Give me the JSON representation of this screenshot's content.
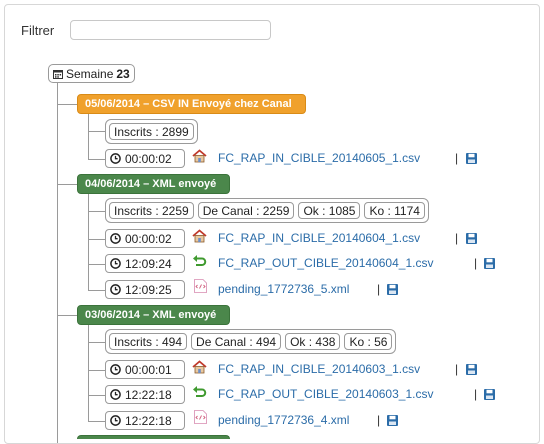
{
  "filter": {
    "label": "Filtrer",
    "value": "",
    "placeholder": ""
  },
  "week": {
    "label": "Semaine",
    "number": "23"
  },
  "separator": "|",
  "days": [
    {
      "title": "05/06/2014 – CSV IN Envoyé chez Canal",
      "status_color": "#f0a12c",
      "stats": [
        "Inscrits : 2899"
      ],
      "files": [
        {
          "time": "00:00:02",
          "icon": "house-icon",
          "name": "FC_RAP_IN_CIBLE_20140605_1.csv"
        }
      ]
    },
    {
      "title": "04/06/2014 – XML envoyé",
      "status_color": "#4b874b",
      "stats": [
        "Inscrits : 2259",
        "De Canal : 2259",
        "Ok : 1085",
        "Ko : 1174"
      ],
      "files": [
        {
          "time": "00:00:02",
          "icon": "house-icon",
          "name": "FC_RAP_IN_CIBLE_20140604_1.csv"
        },
        {
          "time": "12:09:24",
          "icon": "return-arrow-icon",
          "name": "FC_RAP_OUT_CIBLE_20140604_1.csv"
        },
        {
          "time": "12:09:25",
          "icon": "xml-file-icon",
          "name": "pending_1772736_5.xml"
        }
      ]
    },
    {
      "title": "03/06/2014 – XML envoyé",
      "status_color": "#4b874b",
      "stats": [
        "Inscrits : 494",
        "De Canal : 494",
        "Ok : 438",
        "Ko : 56"
      ],
      "files": [
        {
          "time": "00:00:01",
          "icon": "house-icon",
          "name": "FC_RAP_IN_CIBLE_20140603_1.csv"
        },
        {
          "time": "12:22:18",
          "icon": "return-arrow-icon",
          "name": "FC_RAP_OUT_CIBLE_20140603_1.csv"
        },
        {
          "time": "12:22:18",
          "icon": "xml-file-icon",
          "name": "pending_1772736_4.xml"
        }
      ]
    }
  ]
}
